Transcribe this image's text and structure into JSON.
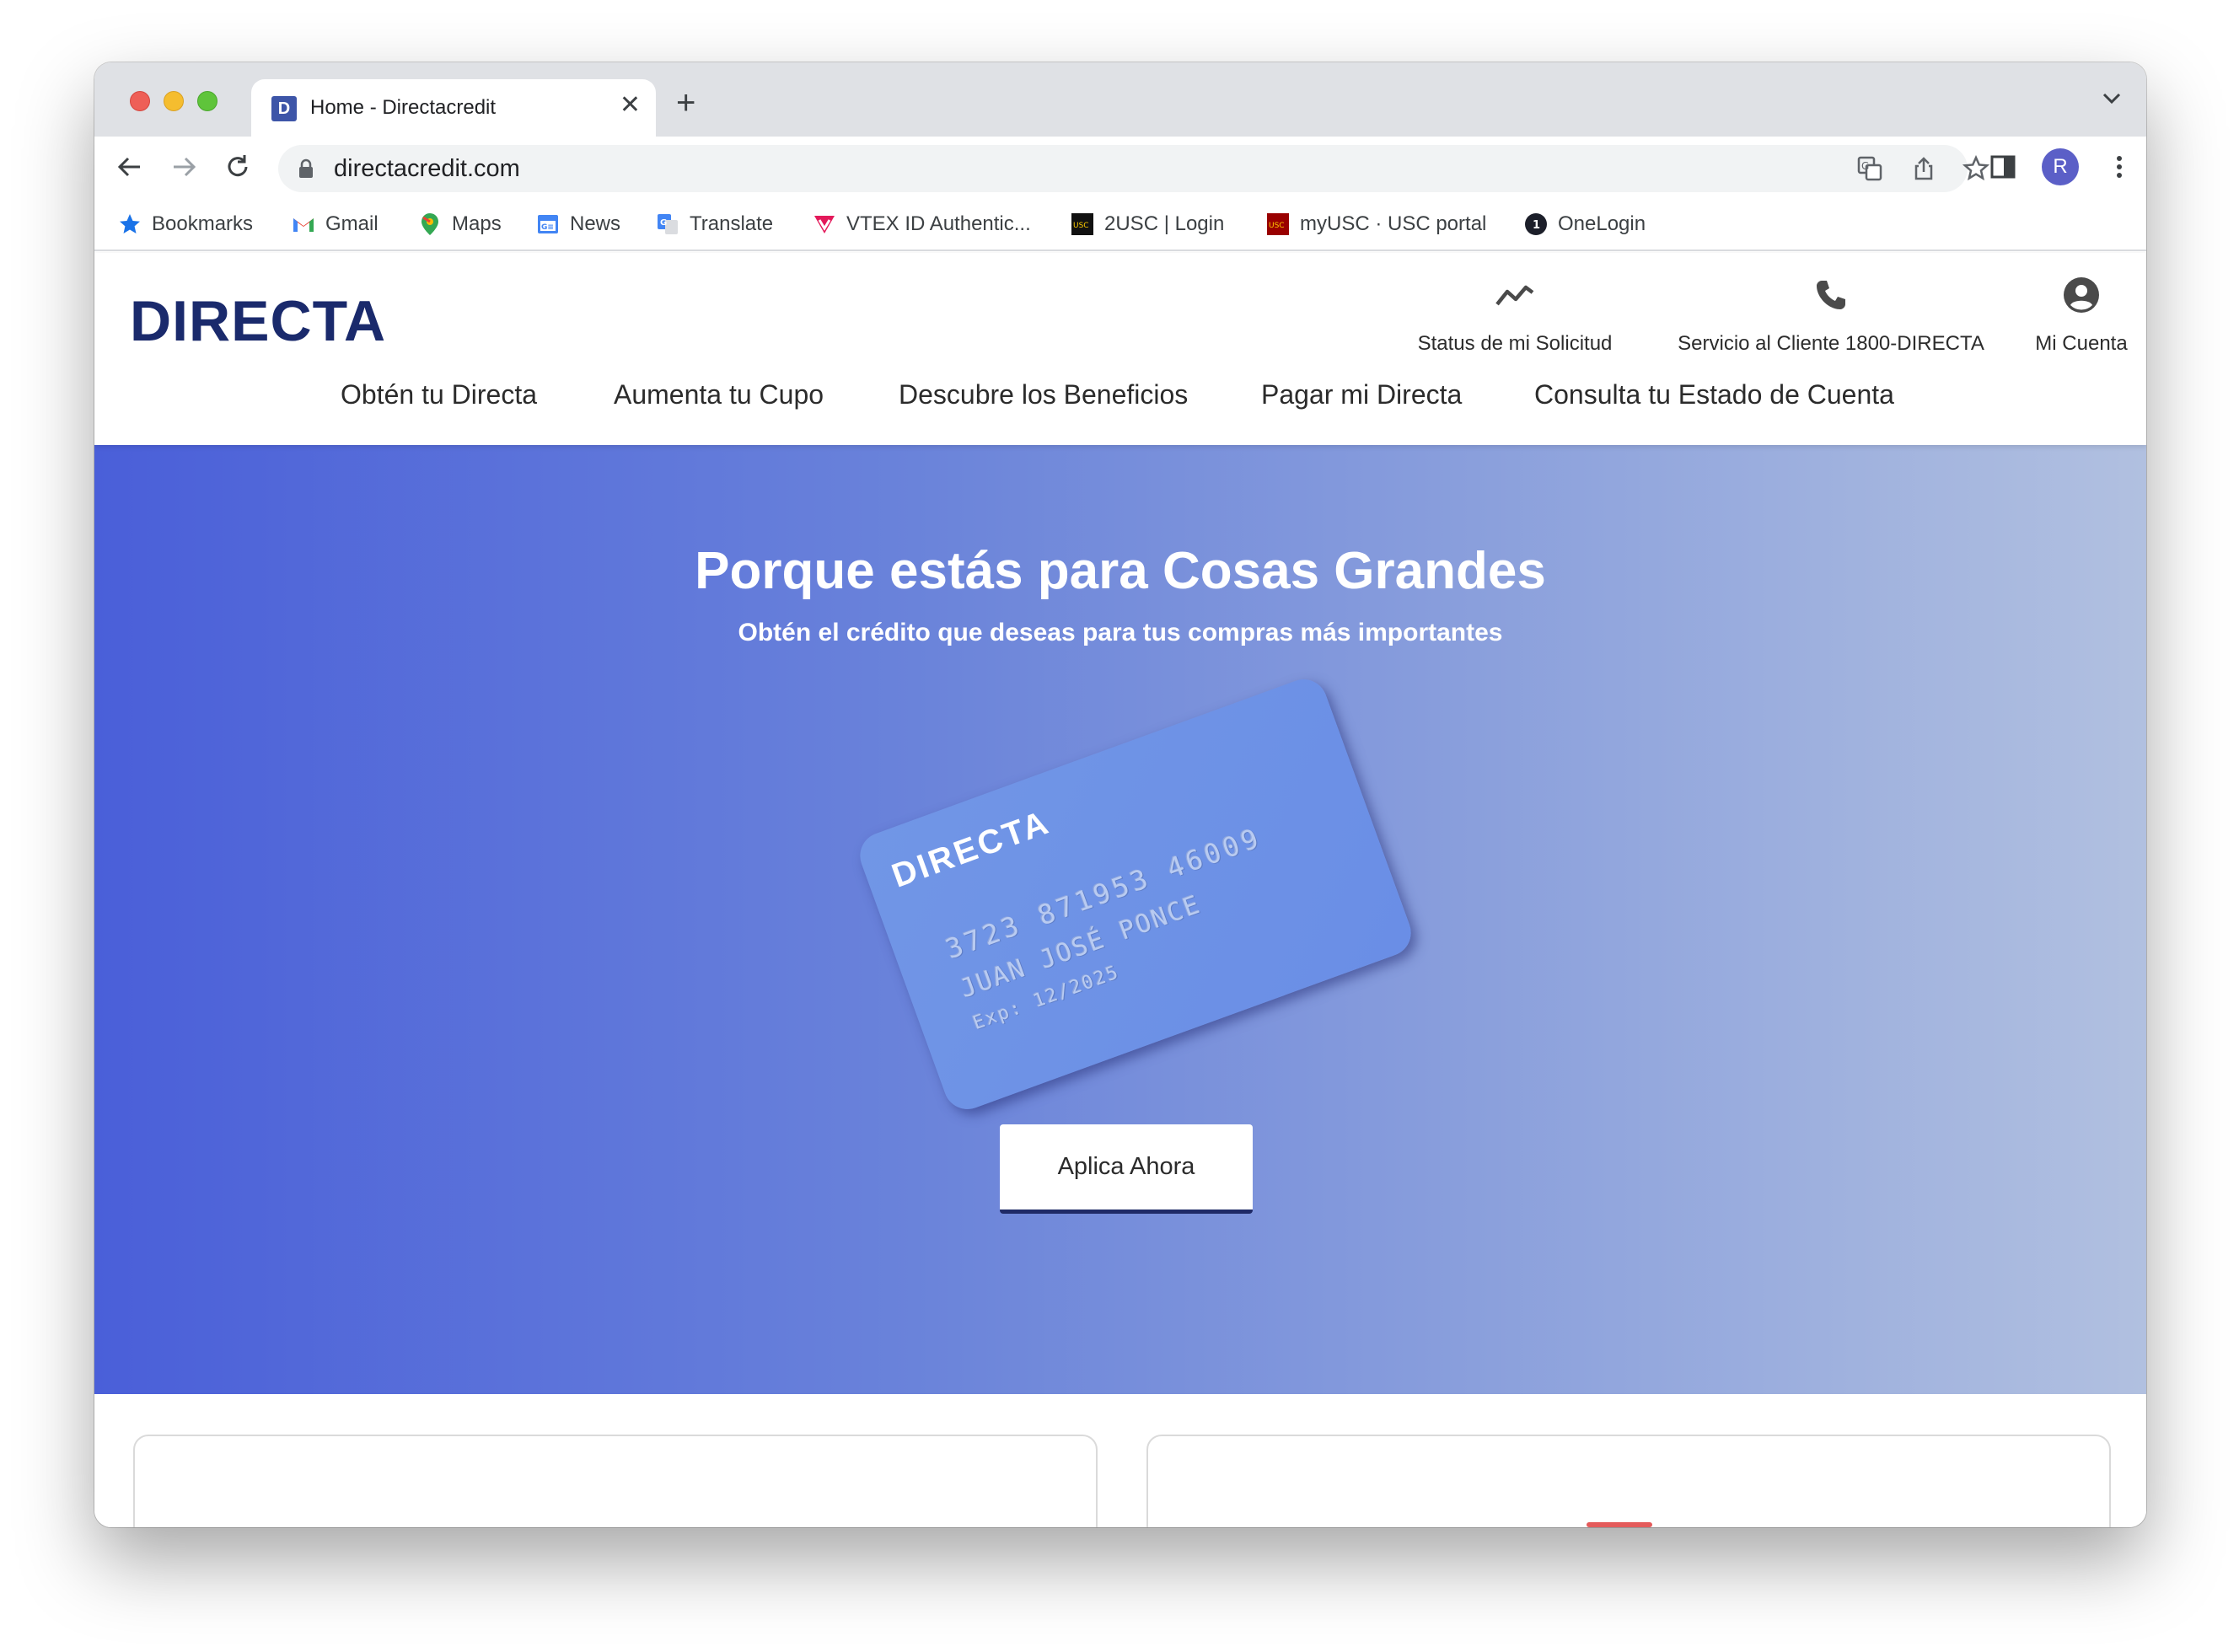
{
  "browser": {
    "tab": {
      "favicon_letter": "D",
      "title": "Home - Directacredit"
    },
    "new_tab_symbol": "+",
    "url": "directacredit.com",
    "profile_initial": "R",
    "bookmarks": [
      {
        "label": "Bookmarks",
        "icon": "star-icon"
      },
      {
        "label": "Gmail",
        "icon": "gmail-icon"
      },
      {
        "label": "Maps",
        "icon": "maps-icon"
      },
      {
        "label": "News",
        "icon": "news-icon"
      },
      {
        "label": "Translate",
        "icon": "translate-icon"
      },
      {
        "label": "VTEX ID Authentic...",
        "icon": "vtex-icon"
      },
      {
        "label": "2USC | Login",
        "icon": "usc-icon"
      },
      {
        "label": "myUSC · USC portal",
        "icon": "usc-icon"
      },
      {
        "label": "OneLogin",
        "icon": "onelogin-icon"
      }
    ]
  },
  "site": {
    "logo": "DIRECTA",
    "utility_links": [
      {
        "label": "Status de mi Solicitud",
        "icon": "trend-icon"
      },
      {
        "label": "Servicio al Cliente 1800-DIRECTA",
        "icon": "phone-icon"
      },
      {
        "label": "Mi Cuenta",
        "icon": "account-icon"
      }
    ],
    "nav": [
      "Obtén tu Directa",
      "Aumenta tu Cupo",
      "Descubre los Beneficios",
      "Pagar mi Directa",
      "Consulta tu Estado de Cuenta"
    ]
  },
  "hero": {
    "title": "Porque estás para Cosas Grandes",
    "subtitle": "Obtén el crédito que deseas para tus compras más importantes",
    "card": {
      "brand": "DIRECTA",
      "number": "3723 871953 46009",
      "holder": "JUAN JOSÉ PONCE",
      "expiry": "Exp: 12/2025"
    },
    "cta": "Aplica Ahora"
  },
  "colors": {
    "brand_navy": "#1a2a6c",
    "hero_start": "#4a5fd9",
    "hero_end": "#b1c0e0",
    "card": "#6e93e6"
  }
}
